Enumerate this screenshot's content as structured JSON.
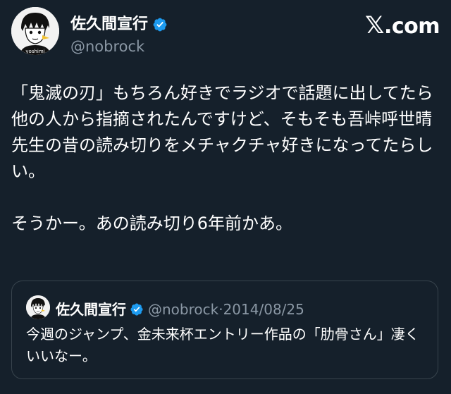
{
  "site": {
    "logo_mark": "𝕏",
    "logo_domain": ".com"
  },
  "author": {
    "display_name": "佐久間宣行",
    "handle": "@nobrock",
    "avatar_label": "yoshimi",
    "verified_color": "#1d9bf0"
  },
  "tweet": {
    "paragraph_1": "「鬼滅の刃」もちろん好きでラジオで話題に出してたら他の人から指摘されたんですけど、そもそも吾峠呼世晴先生の昔の読み切りをメチャクチャ好きになってたらしい。",
    "paragraph_2": "そうかー。あの読み切り6年前かあ。"
  },
  "quoted_tweet": {
    "display_name": "佐久間宣行",
    "handle": "@nobrock",
    "separator": "·",
    "date": "2014/08/25",
    "text": "今週のジャンプ、金未来杯エントリー作品の「肋骨さん」凄くいいなー。"
  },
  "colors": {
    "background": "#15202b",
    "secondary_text": "#8b98a5",
    "border": "#38444d",
    "verified_blue": "#1d9bf0"
  }
}
